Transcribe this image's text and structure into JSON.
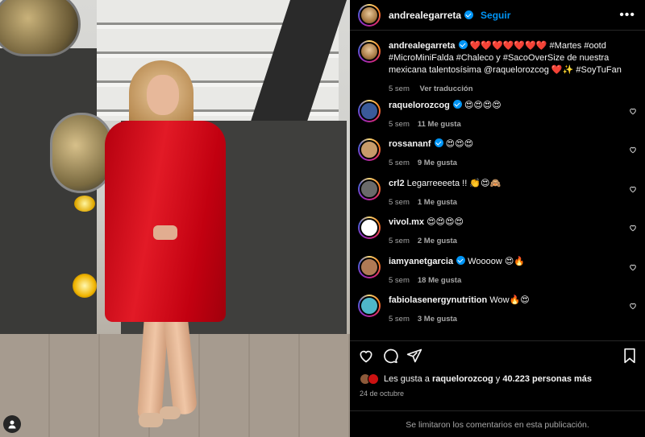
{
  "post": {
    "author": "andrealegarreta",
    "follow_label": "Seguir",
    "caption_author": "andrealegarreta",
    "caption": "❤️❤️❤️❤️❤️❤️❤️ #Martes #ootd #MicroMiniFalda #Chaleco y #SacoOverSize de nuestra mexicana talentosísima @raquelorozcog ❤️✨ #SoyTuFan",
    "caption_time": "5 sem",
    "caption_translate": "Ver traducción"
  },
  "comments": [
    {
      "user": "raquelorozcog",
      "verified": true,
      "text": "😍😍😍😍",
      "time": "5 sem",
      "likes": "11 Me gusta",
      "avatar_color": "#3a5a9a"
    },
    {
      "user": "rossananf",
      "verified": true,
      "text": "😍😍😍",
      "time": "5 sem",
      "likes": "9 Me gusta",
      "avatar_color": "#c89b6a"
    },
    {
      "user": "crl2",
      "verified": false,
      "text": "Legarreeeeta !! 👏😍🙈",
      "time": "5 sem",
      "likes": "1 Me gusta",
      "avatar_color": "#6a6a6a"
    },
    {
      "user": "vivol.mx",
      "verified": false,
      "text": "😍😍😍😍",
      "time": "5 sem",
      "likes": "2 Me gusta",
      "avatar_color": "#ffffff"
    },
    {
      "user": "iamyanetgarcia",
      "verified": true,
      "text": "Woooow 😍🔥",
      "time": "5 sem",
      "likes": "18 Me gusta",
      "avatar_color": "#b07a55"
    },
    {
      "user": "fabiolasenergynutrition",
      "verified": false,
      "text": "Wow🔥😍",
      "time": "5 sem",
      "likes": "3 Me gusta",
      "avatar_color": "#4fb7c9"
    }
  ],
  "likes": {
    "prefix": "Les gusta a",
    "user": "raquelorozcog",
    "middle": "y",
    "count": "40.223 personas más"
  },
  "date": "24 de octubre",
  "comments_limited": "Se limitaron los comentarios en esta publicación.",
  "icons": [
    "heart-icon",
    "comment-icon",
    "share-icon",
    "bookmark-icon",
    "more-icon",
    "user-tag-icon"
  ],
  "colors": {
    "link_blue": "#0095f6",
    "verified": "#0095f6",
    "muted": "#a8a8a8"
  }
}
